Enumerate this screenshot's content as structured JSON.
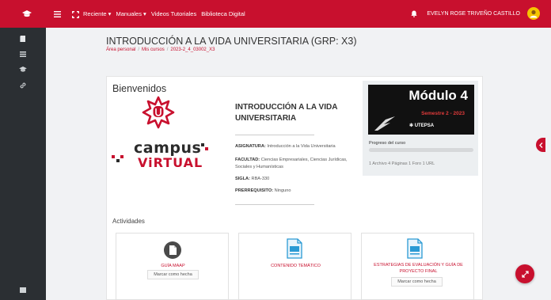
{
  "topbar": {
    "menu": [
      "Reciente ▾",
      "Manuales ▾",
      "Videos Tutoriales",
      "Biblioteca Digital"
    ],
    "user_name": "EVELYN ROSE TRIVEÑO CASTILLO"
  },
  "page": {
    "title": "INTRODUCCIÓN A LA VIDA UNIVERSITARIA (GRP: X3)",
    "breadcrumb": [
      "Área personal",
      "Mis cursos",
      "2023-2_4_03002_X3"
    ]
  },
  "welcome": {
    "heading": "Bienvenidos",
    "logo_text_1": "campus",
    "logo_text_2": "ViRTUAL"
  },
  "course": {
    "name": "INTRODUCCIÓN A LA VIDA UNIVERSITARIA",
    "asignatura_label": "ASIGNATURA:",
    "asignatura": "Introducción a la Vida Universitaria",
    "facultad_label": "FACULTAD:",
    "facultad": "Ciencias Empresariales, Ciencias Jurídicas, Sociales y Humanísticas",
    "sigla_label": "SIGLA:",
    "sigla": "RBA-330",
    "prerreq_label": "PRERREQUISITO:",
    "prerreq": "Ninguno"
  },
  "module": {
    "title": "Módulo 4",
    "semester": "Semestre 2 - 2023",
    "brand": "UTEPSA",
    "progress_label": "Progreso del curso",
    "progress": 0.0,
    "stats": "1 Archivo  4 Páginas  1 Foro  1 URL"
  },
  "activities": {
    "heading": "Actividades",
    "items": [
      {
        "label": "GUÍA MAAP",
        "button": "Marcar como hecha"
      },
      {
        "label": "CONTENIDO TEMÁTICO",
        "button": ""
      },
      {
        "label": "ESTRATEGIAS DE EVALUACIÓN Y GUÍA DE PROYECTO FINAL",
        "button": "Marcar como hecha"
      }
    ]
  },
  "colors": {
    "brand_red": "#c8102e",
    "sidebar": "#2b2f33",
    "doc_icon_blue": "#2a9ad4",
    "doc_icon_dark": "#4a4a4a"
  },
  "icons": [
    "graduation-cap-icon",
    "menu-icon",
    "expand-icon",
    "bell-icon",
    "dashboard-icon",
    "calendar-icon",
    "courses-icon",
    "link-icon",
    "sidebar-footer-icon",
    "chevron-left-icon",
    "arrows-expand-icon"
  ]
}
